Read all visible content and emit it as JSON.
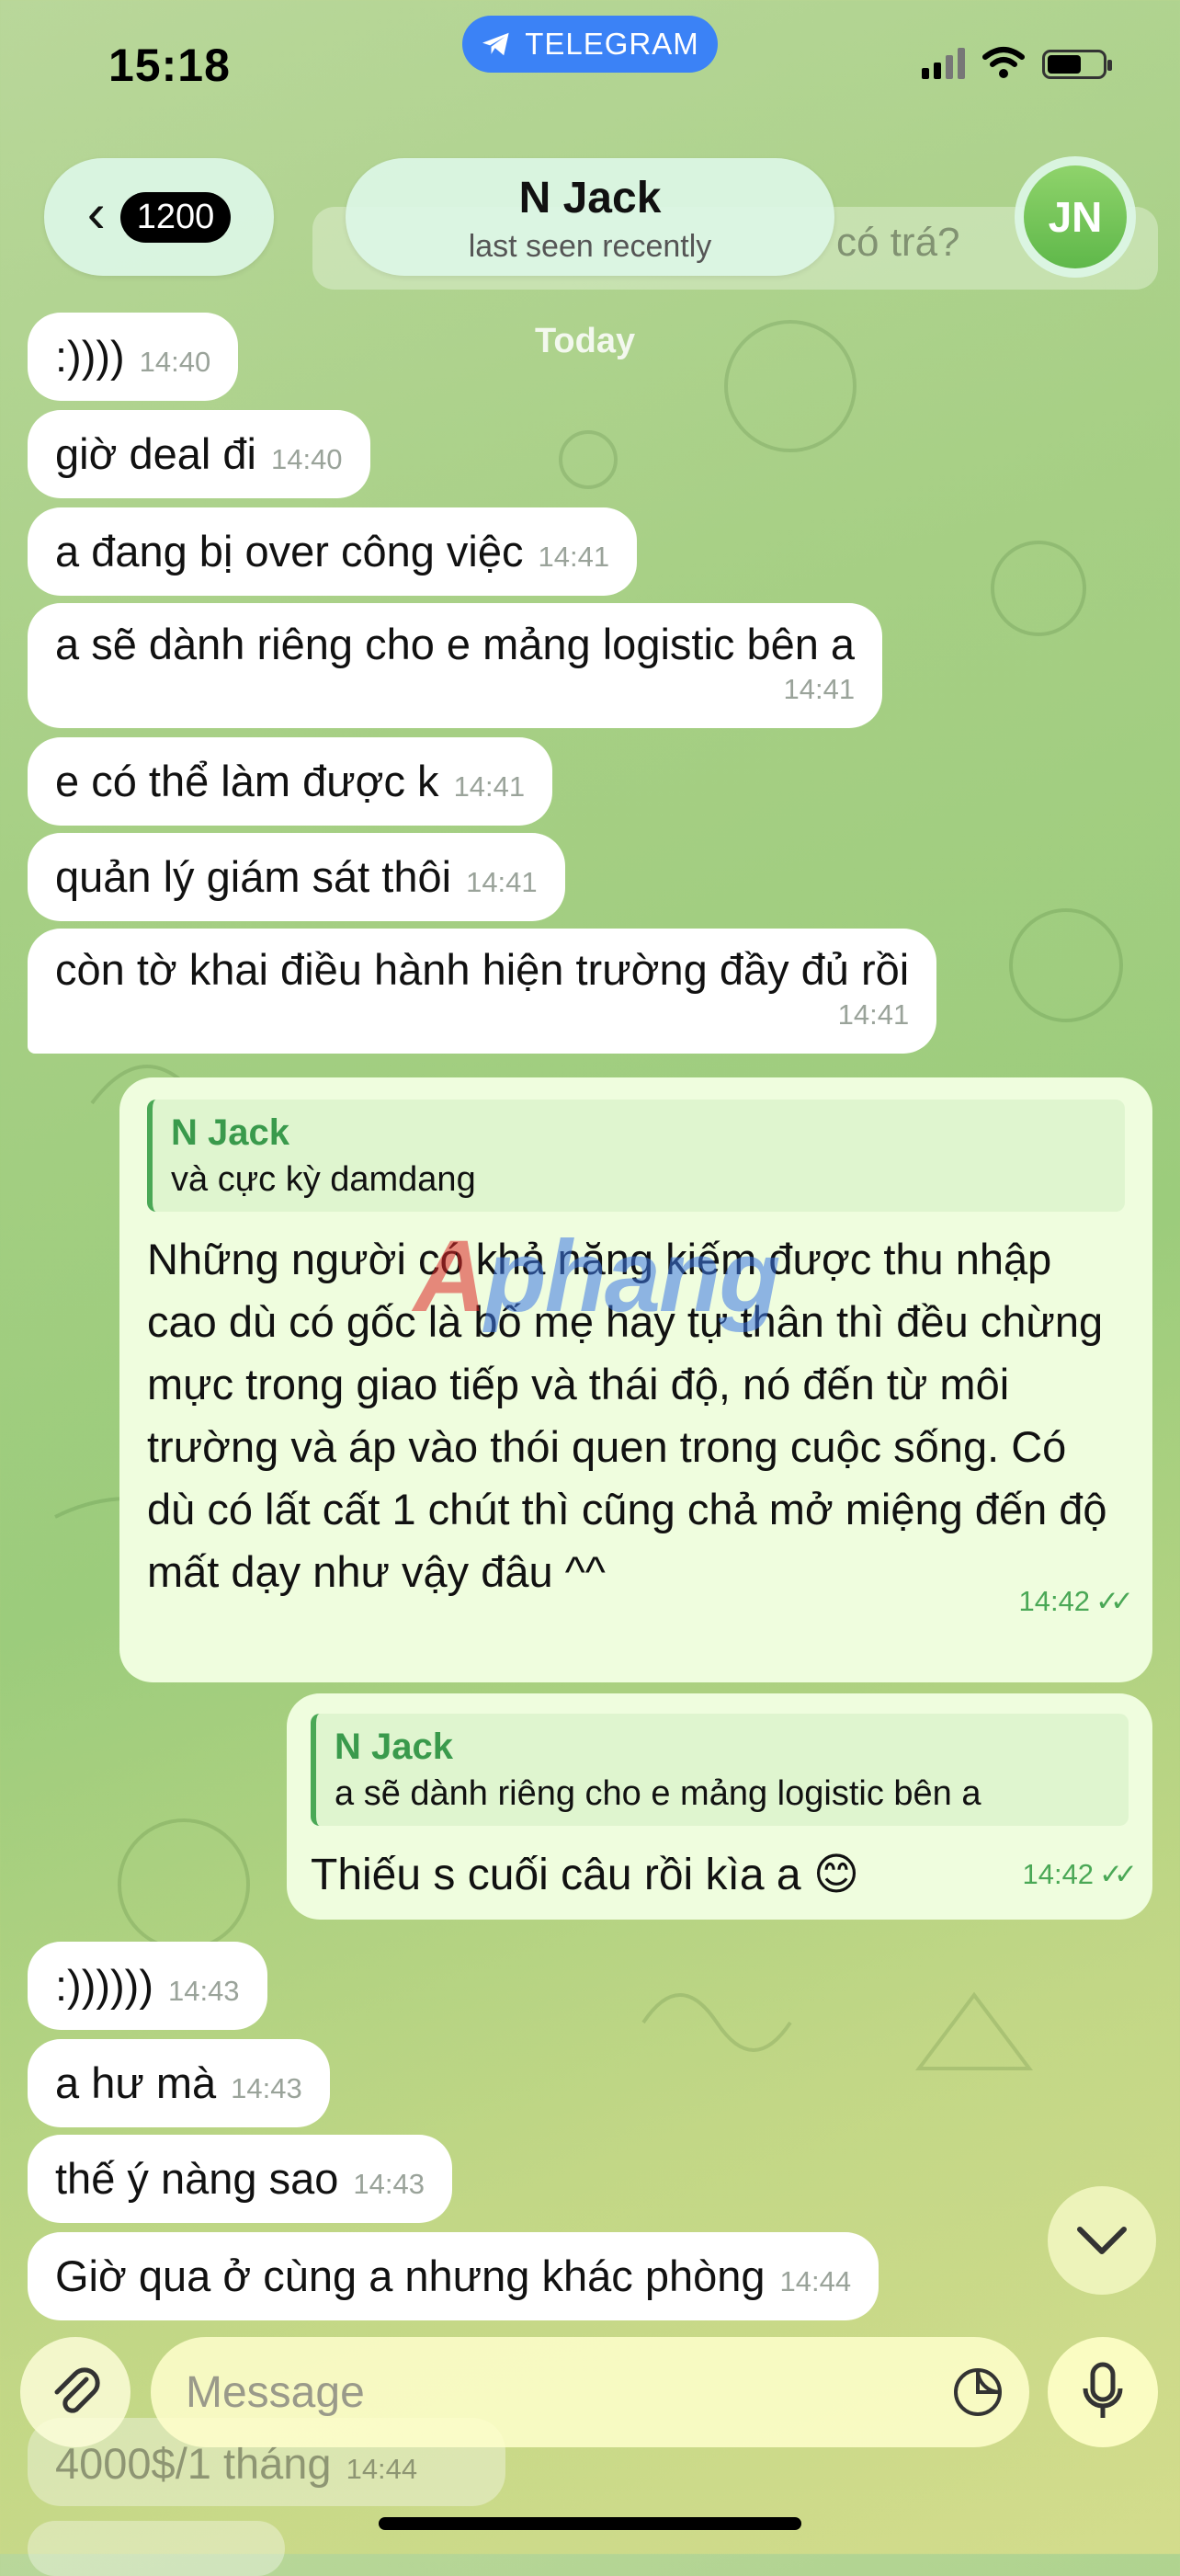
{
  "status_bar": {
    "time": "15:18",
    "telegram_label": "TELEGRAM"
  },
  "header": {
    "back_count": "1200",
    "contact_name": "N Jack",
    "contact_status": "last seen recently",
    "avatar_initials": "JN"
  },
  "pinned_ghost_text": "có trá?",
  "date_chip": "Today",
  "messages": [
    {
      "text": ":))))",
      "time": "14:40"
    },
    {
      "text": "giờ deal đi",
      "time": "14:40"
    },
    {
      "text": "a đang bị over công việc",
      "time": "14:41"
    },
    {
      "text": "a sẽ dành riêng cho e mảng logistic bên a",
      "time": "14:41"
    },
    {
      "text": "e có thể làm được k",
      "time": "14:41"
    },
    {
      "text": "quản lý giám sát thôi",
      "time": "14:41"
    },
    {
      "text": "còn tờ khai điều hành hiện trường đầy đủ rồi",
      "time": "14:41"
    },
    {
      "text": ":))))))",
      "time": "14:43"
    },
    {
      "text": "a hư mà",
      "time": "14:43"
    },
    {
      "text": "thế ý nàng sao",
      "time": "14:43"
    },
    {
      "text": "Giờ qua ở cùng a nhưng khác phòng",
      "time": "14:44"
    }
  ],
  "outgoing": [
    {
      "reply_name": "N Jack",
      "reply_text": "và cực kỳ damdang",
      "text": "Những người có khả năng kiếm được thu nhập cao dù có gốc là bố mẹ hay tự thân thì đều chừng mực trong giao tiếp và thái độ, nó đến từ môi trường và áp vào thói quen trong cuộc sống. Có dù có lất cất 1 chút thì cũng chả mở miệng đến độ mất dạy như vậy đâu ^^",
      "time": "14:42"
    },
    {
      "reply_name": "N Jack",
      "reply_text": "a sẽ dành riêng cho e mảng logistic bên a",
      "text": "Thiếu s cuối câu rồi kìa a 😊",
      "time": "14:42"
    }
  ],
  "watermark": {
    "part1": "A",
    "part2": "phang"
  },
  "ghost_message": {
    "text": "4000$/1 tháng",
    "time": "14:44"
  },
  "composer": {
    "placeholder": "Message"
  },
  "colors": {
    "accent": "#4aa856",
    "telegram_blue": "#3b82f6",
    "outgoing_bubble": "#effdde"
  }
}
